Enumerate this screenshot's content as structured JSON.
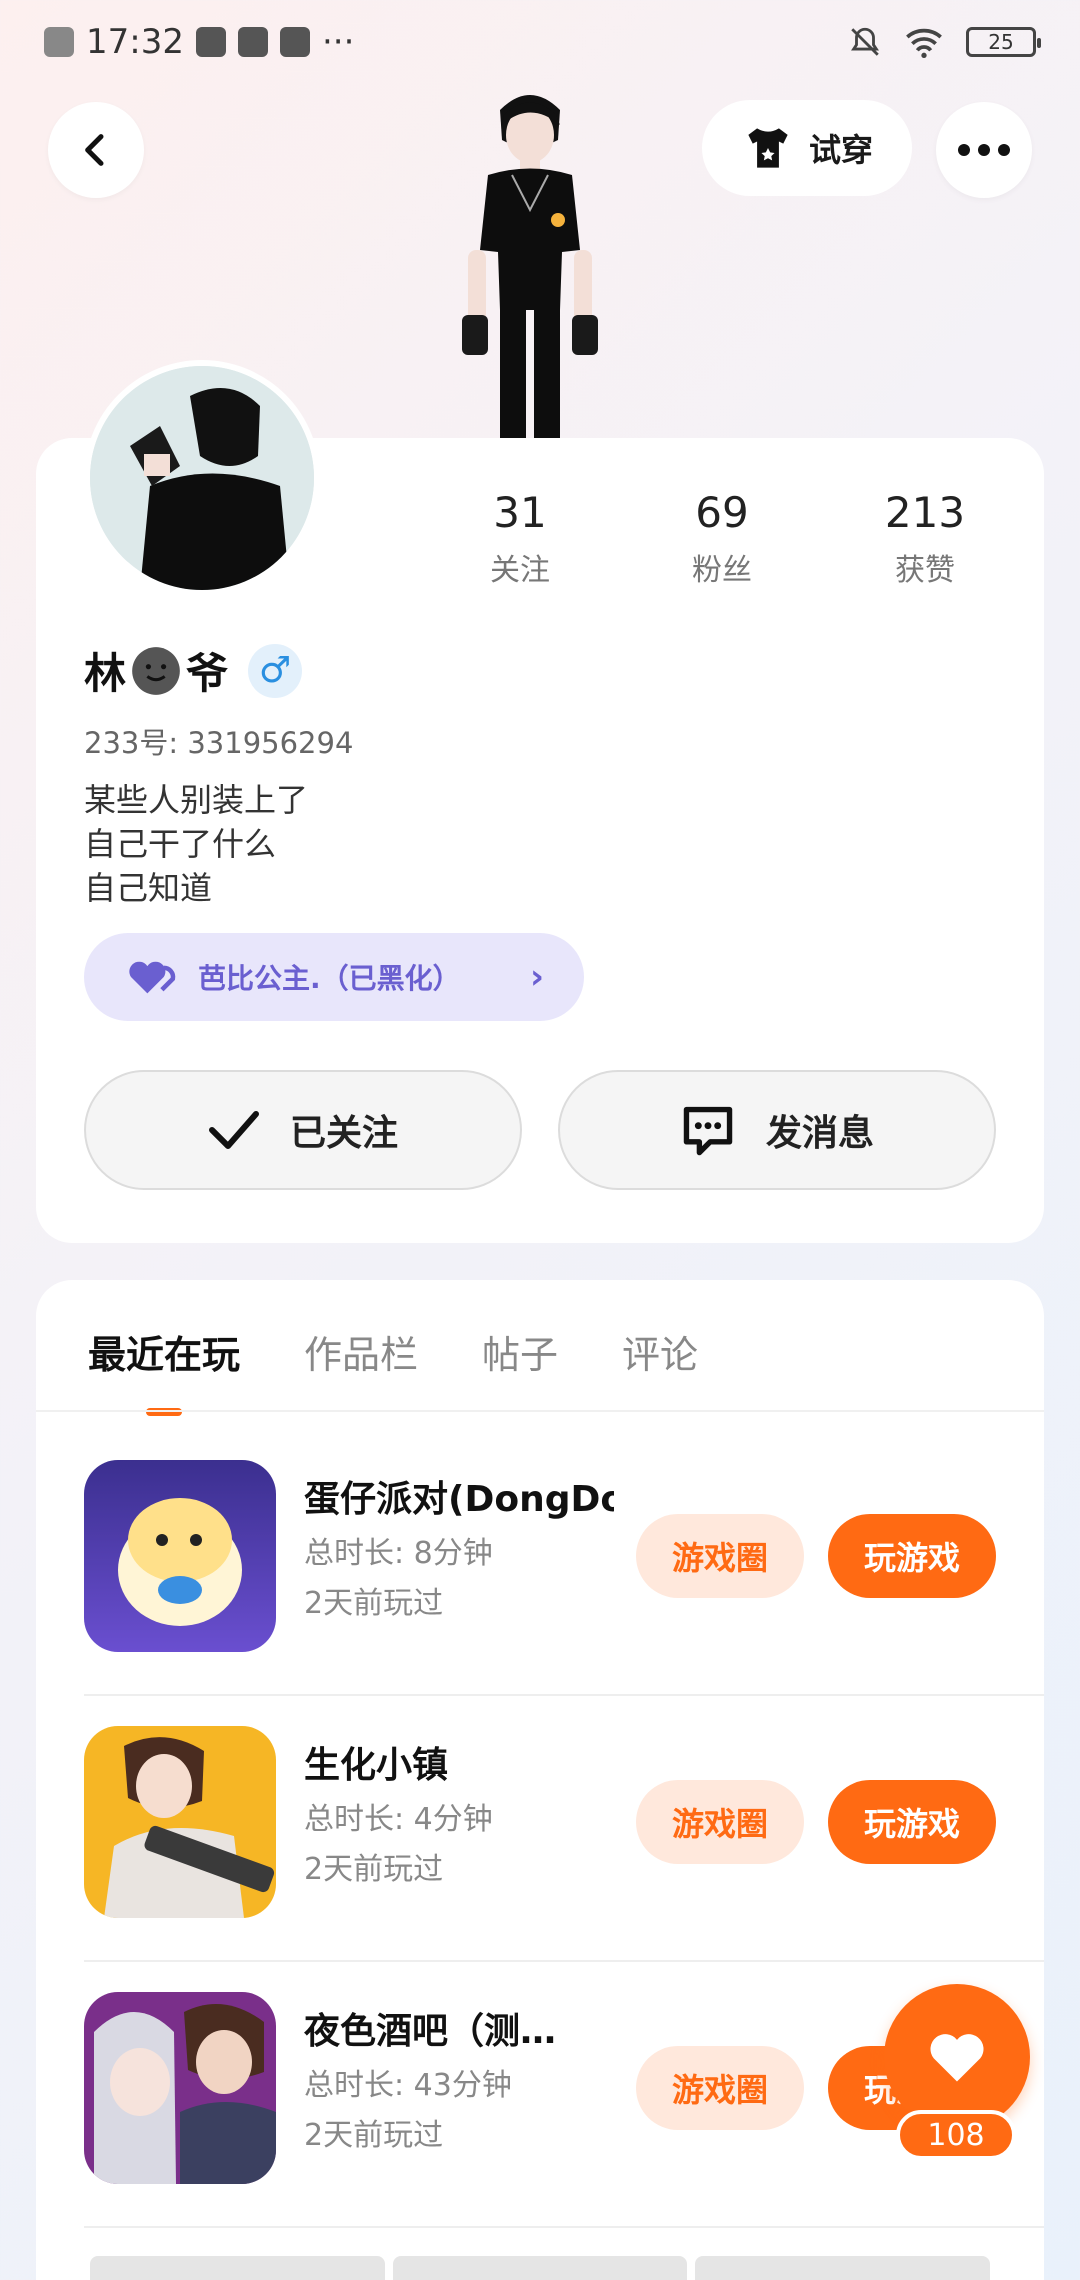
{
  "status_bar": {
    "time": "17:32",
    "battery": "25",
    "more_dots": "···",
    "icons": [
      "close-notification-icon",
      "pinwheel-icon",
      "play-icon",
      "mail-icon",
      "bell-muted-icon",
      "wifi-icon",
      "battery-icon"
    ]
  },
  "header": {
    "back_icon": "back-icon",
    "try_on_label": "试穿",
    "more_icon": "more-icon"
  },
  "profile": {
    "stats": [
      {
        "value": "31",
        "label": "关注"
      },
      {
        "value": "69",
        "label": "粉丝"
      },
      {
        "value": "213",
        "label": "获赞"
      }
    ],
    "name_part1": "林",
    "name_part2": "爷",
    "gender_symbol": "♂",
    "uid": "233号: 331956294",
    "bio": [
      "某些人别装上了",
      "自己干了什么",
      "自己知道"
    ],
    "group_label": "芭比公主.（已黑化）",
    "group_chevron": "›",
    "follow_label": "已关注",
    "message_label": "发消息"
  },
  "tabs": [
    "最近在玩",
    "作品栏",
    "帖子",
    "评论"
  ],
  "games": [
    {
      "title": "蛋仔派对(DongDo…",
      "duration": "总时长: 8分钟",
      "last_played": "2天前玩过",
      "circle_label": "游戏圈",
      "play_label": "玩游戏"
    },
    {
      "title": "生化小镇",
      "duration": "总时长: 4分钟",
      "last_played": "2天前玩过",
      "circle_label": "游戏圈",
      "play_label": "玩游戏"
    },
    {
      "title": "夜色酒吧（测…",
      "duration": "总时长: 43分钟",
      "last_played": "2天前玩过",
      "circle_label": "游戏圈",
      "play_label": "玩游戏"
    }
  ],
  "like": {
    "count": "108"
  },
  "colors": {
    "accent": "#ff6a13",
    "accent_light": "#ffe8dc",
    "group_bg": "#e8e6fb",
    "group_text": "#6a5fd0"
  }
}
